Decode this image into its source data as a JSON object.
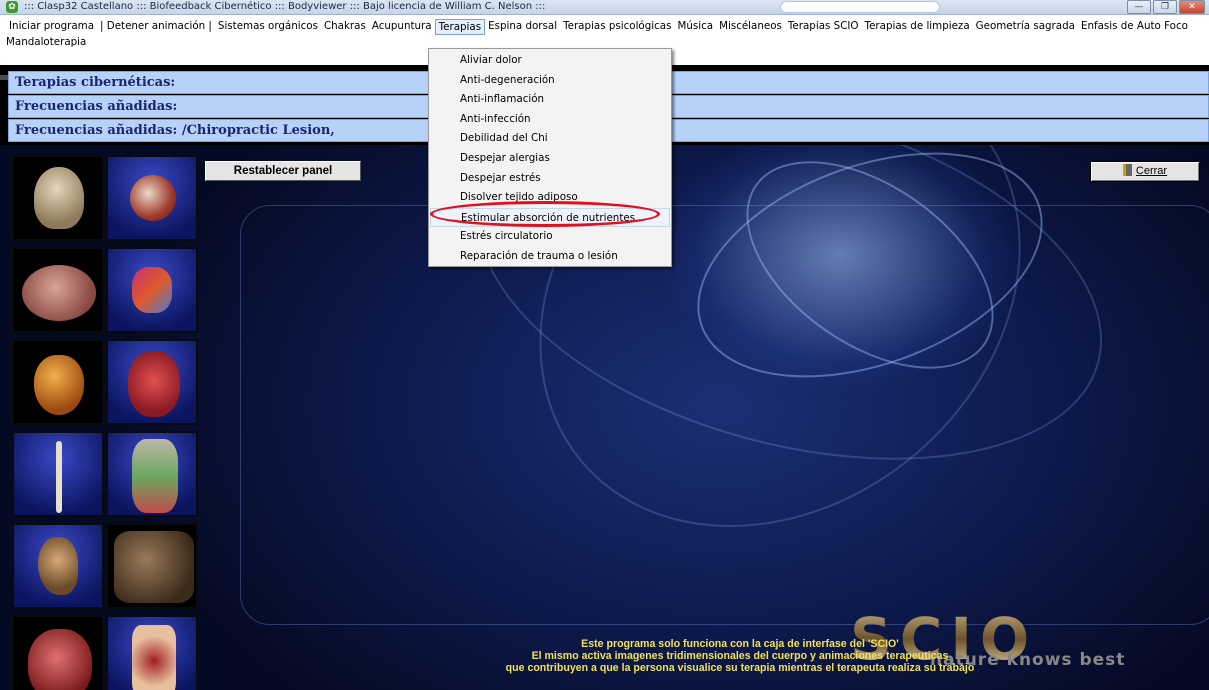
{
  "window": {
    "title": "::: Clasp32 Castellano ::: Biofeedback Cibernético ::: Bodyviewer ::: Bajo licencia de William C. Nelson :::",
    "icon": "app-icon"
  },
  "menu": {
    "items": [
      "Iniciar programa",
      "| Detener animación |",
      "Sistemas orgánicos",
      "Chakras",
      "Acupuntura",
      "Terapias",
      "Espina dorsal",
      "Terapias psicológicas",
      "Música",
      "Miscélaneos",
      "Terapias SCIO",
      "Terapias de limpieza",
      "Geometría sagrada",
      "Enfasis de Auto Foco"
    ],
    "row2": "Mandaloterapia",
    "active_index": 5
  },
  "info_bars": [
    "Terapias cibernéticas:",
    "Frecuencias añadidas:",
    "Frecuencias añadidas: /Chiropractic Lesion,"
  ],
  "dropdown": {
    "items": [
      "Aliviar dolor",
      "Anti-degeneración",
      "Anti-inflamación",
      "Anti-infección",
      "Debilidad del Chi",
      "Despejar alergias",
      "Despejar estrés",
      "Disolver tejido adiposo",
      "Estimular absorción de nutrientes",
      "Estrés circulatorio",
      "Reparación de trauma o lesión"
    ],
    "hovered_index": 8
  },
  "buttons": {
    "reset": "Restablecer panel",
    "close": "Cerrar"
  },
  "organs": [
    "skull",
    "eye",
    "brain",
    "digestive-organs",
    "heart",
    "heart-cross-section",
    "skeleton-arm",
    "torso-organs",
    "ear",
    "muscle",
    "lungs",
    "skin"
  ],
  "footer": {
    "line1": "Este programa solo funciona con la caja de interfase del 'SCIO'",
    "line2": "El mismo activa imagenes tridimensionales del cuerpo y animaciones terapeuticas",
    "line3": "que contribuyen a que la persona visualice su terapia mientras el terapeuta realiza su trabajo"
  },
  "logo": {
    "letters": "SCIO",
    "tagline": "nature knows best"
  },
  "colors": {
    "info_bar_bg": "#b7d2f9",
    "info_bar_text": "#1d2470",
    "footer_text": "#f1e15b",
    "highlight": "#e01020"
  }
}
